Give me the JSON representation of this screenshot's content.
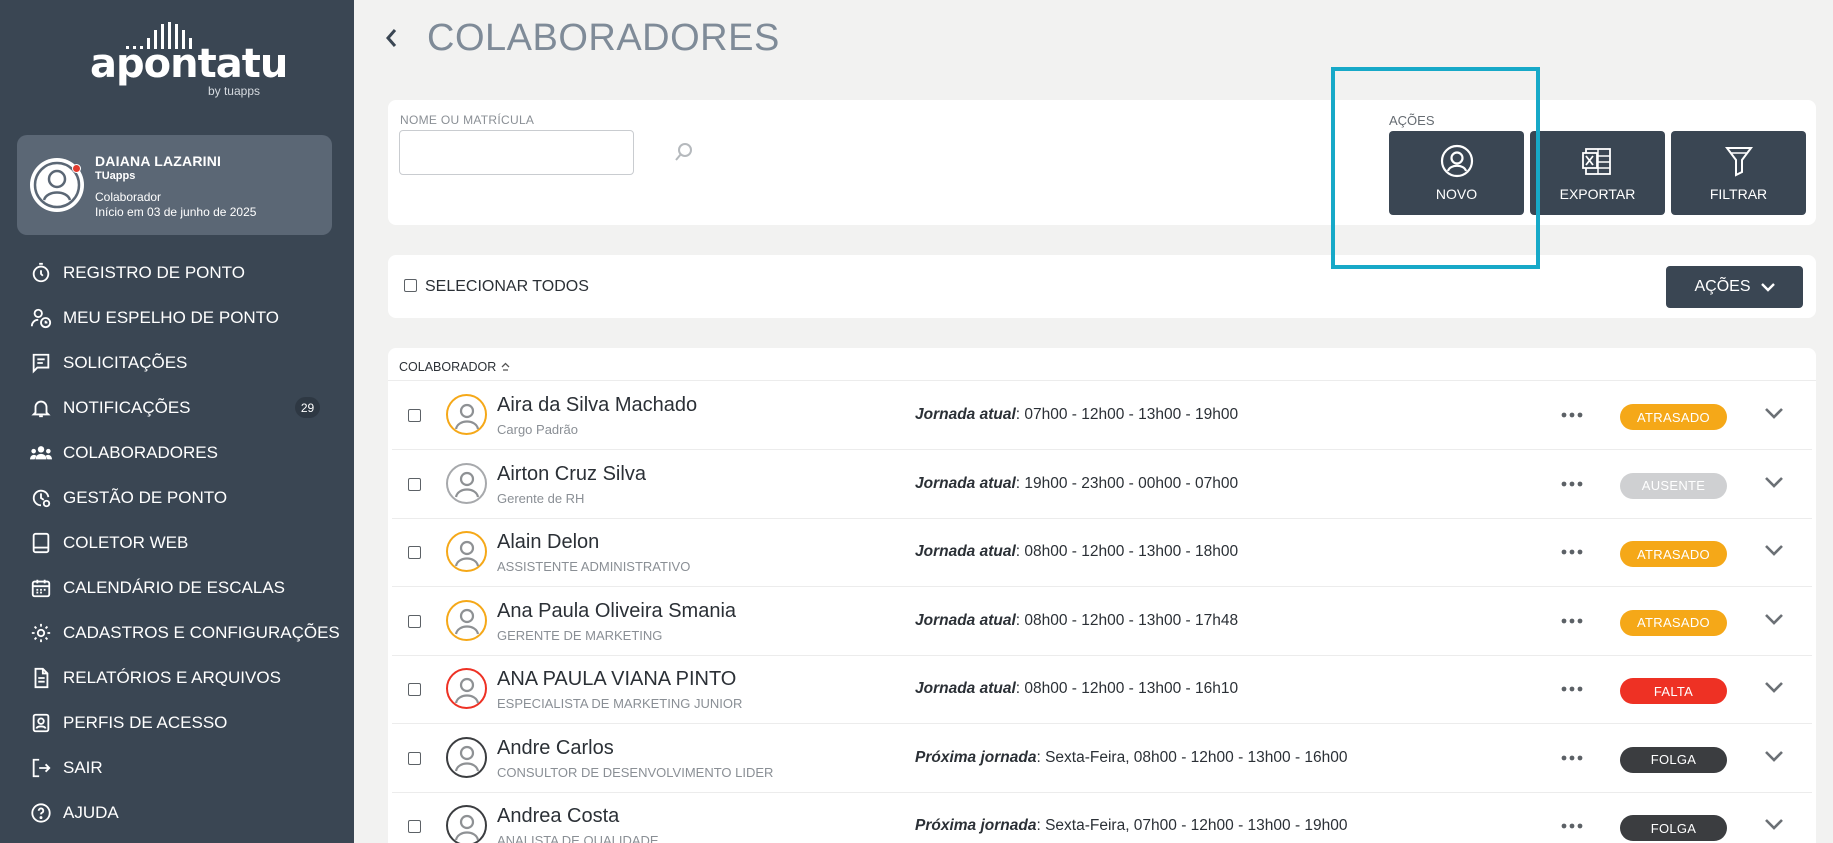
{
  "brand": {
    "name": "apontatu",
    "byline": "by tuapps"
  },
  "user": {
    "name": "DAIANA LAZARINI",
    "company": "TUapps",
    "role": "Colaborador",
    "since": "Início em 03 de junho de 2025"
  },
  "nav": {
    "items": [
      {
        "label": "REGISTRO DE PONTO",
        "icon": "stopwatch-icon"
      },
      {
        "label": "MEU ESPELHO DE PONTO",
        "icon": "user-clock-icon"
      },
      {
        "label": "SOLICITAÇÕES",
        "icon": "request-icon"
      },
      {
        "label": "NOTIFICAÇÕES",
        "icon": "bell-icon",
        "badge": "29"
      },
      {
        "label": "COLABORADORES",
        "icon": "users-icon"
      },
      {
        "label": "GESTÃO DE PONTO",
        "icon": "clock-gear-icon"
      },
      {
        "label": "COLETOR WEB",
        "icon": "tablet-icon"
      },
      {
        "label": "CALENDÁRIO DE ESCALAS",
        "icon": "calendar-icon"
      },
      {
        "label": "CADASTROS E CONFIGURAÇÕES",
        "icon": "gear-icon"
      },
      {
        "label": "RELATÓRIOS E ARQUIVOS",
        "icon": "document-icon"
      },
      {
        "label": "PERFIS DE ACESSO",
        "icon": "badge-icon"
      },
      {
        "label": "SAIR",
        "icon": "logout-icon"
      },
      {
        "label": "AJUDA",
        "icon": "help-icon"
      }
    ]
  },
  "page": {
    "title": "COLABORADORES",
    "back_icon": "chevron-left-icon"
  },
  "filter": {
    "search_label": "NOME OU MATRÍCULA",
    "search_value": "",
    "actions_label": "AÇÕES",
    "new_label": "NOVO",
    "export_label": "EXPORTAR",
    "filter_label": "FILTRAR"
  },
  "selection": {
    "select_all_label": "SELECIONAR TODOS",
    "actions_dropdown": "AÇÕES"
  },
  "list": {
    "column_header": "COLABORADOR",
    "rows": [
      {
        "name": "Aira da Silva Machado",
        "role": "Cargo Padrão",
        "sched_label": "Jornada atual",
        "sched": ": 07h00 - 12h00  -  13h00 - 19h00",
        "status": "ATRASADO",
        "status_color": "#f5a818",
        "avatar_color": "#f5a818"
      },
      {
        "name": "Airton Cruz Silva",
        "role": "Gerente de RH",
        "sched_label": "Jornada atual",
        "sched": ": 19h00 - 23h00  -  00h00 - 07h00",
        "status": "AUSENTE",
        "status_color": "#cfd0d2",
        "avatar_color": "#a7a9ac"
      },
      {
        "name": "Alain Delon",
        "role": "ASSISTENTE ADMINISTRATIVO",
        "sched_label": "Jornada atual",
        "sched": ": 08h00 - 12h00  -  13h00 - 18h00",
        "status": "ATRASADO",
        "status_color": "#f5a818",
        "avatar_color": "#f5a818"
      },
      {
        "name": "Ana Paula Oliveira Smania",
        "role": "GERENTE DE MARKETING",
        "sched_label": "Jornada atual",
        "sched": ": 08h00 - 12h00  -  13h00 - 17h48",
        "status": "ATRASADO",
        "status_color": "#f5a818",
        "avatar_color": "#f5a818"
      },
      {
        "name": "ANA PAULA VIANA PINTO",
        "role": "ESPECIALISTA DE MARKETING JUNIOR",
        "sched_label": "Jornada atual",
        "sched": ": 08h00 - 12h00  -  13h00 - 16h10",
        "status": "FALTA",
        "status_color": "#ee3124",
        "avatar_color": "#ee3124"
      },
      {
        "name": "Andre Carlos",
        "role": "CONSULTOR DE DESENVOLVIMENTO LIDER",
        "sched_label": "Próxima jornada",
        "sched": ": Sexta-Feira, 08h00 - 12h00  -  13h00 - 16h00",
        "status": "FOLGA",
        "status_color": "#3b3d40",
        "avatar_color": "#3b3d40"
      },
      {
        "name": "Andrea Costa",
        "role": "ANALISTA DE QUALIDADE",
        "sched_label": "Próxima jornada",
        "sched": ": Sexta-Feira, 07h00 - 12h00  -  13h00 - 19h00",
        "status": "FOLGA",
        "status_color": "#3b3d40",
        "avatar_color": "#3b3d40"
      }
    ]
  },
  "colors": {
    "sidebar": "#3a4653",
    "accent_highlight": "#17a9c8",
    "button": "#3a4653"
  }
}
